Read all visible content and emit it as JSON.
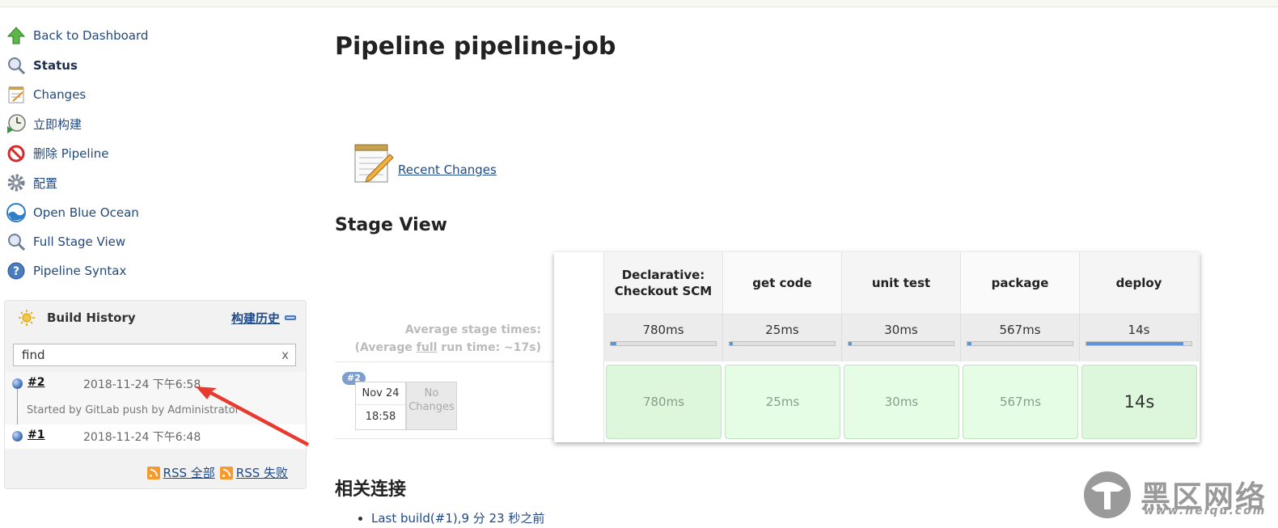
{
  "sidebar": {
    "tasks": [
      {
        "label": "Back to Dashboard",
        "icon": "up-arrow-icon"
      },
      {
        "label": "Status",
        "icon": "search-icon"
      },
      {
        "label": "Changes",
        "icon": "notepad-icon"
      },
      {
        "label": "立即构建",
        "icon": "clock-build-icon"
      },
      {
        "label": "删除 Pipeline",
        "icon": "no-entry-icon"
      },
      {
        "label": "配置",
        "icon": "gear-icon"
      },
      {
        "label": "Open Blue Ocean",
        "icon": "blue-ocean-icon"
      },
      {
        "label": "Full Stage View",
        "icon": "search-icon"
      },
      {
        "label": "Pipeline Syntax",
        "icon": "help-icon"
      }
    ]
  },
  "build_history": {
    "title": "Build History",
    "trend_label": "构建历史",
    "search": {
      "value": "find",
      "clear": "x"
    },
    "builds": [
      {
        "number": "#2",
        "date": "2018-11-24 下午6:58",
        "cause": "Started by GitLab push by Administrator"
      },
      {
        "number": "#1",
        "date": "2018-11-24 下午6:48"
      }
    ],
    "rss_all": "RSS 全部",
    "rss_failed": "RSS 失败"
  },
  "main": {
    "title": "Pipeline pipeline-job",
    "recent_changes": "Recent Changes",
    "stage_view_title": "Stage View",
    "related_title": "相关连接",
    "related_links": [
      "Last build(#1),9 分 23 秒之前"
    ]
  },
  "stage_view": {
    "avg_line1": "Average stage times:",
    "avg_line2_pre": "(Average ",
    "avg_line2_full": "full",
    "avg_line2_post": " run time: ~17s)",
    "run": {
      "badge": "#2",
      "date": "Nov 24",
      "time": "18:58",
      "no_changes": "No Changes"
    },
    "stages": [
      {
        "name": "Declarative: Checkout SCM",
        "avg": "780ms",
        "value": "780ms",
        "bar_fraction": 0.05
      },
      {
        "name": "get code",
        "avg": "25ms",
        "value": "25ms",
        "bar_fraction": 0.03
      },
      {
        "name": "unit test",
        "avg": "30ms",
        "value": "30ms",
        "bar_fraction": 0.03
      },
      {
        "name": "package",
        "avg": "567ms",
        "value": "567ms",
        "bar_fraction": 0.04
      },
      {
        "name": "deploy",
        "avg": "14s",
        "value": "14s",
        "bar_fraction": 0.92
      }
    ]
  },
  "watermark": {
    "text": "黑区网络",
    "url": "www.heiqu.com"
  },
  "colors": {
    "link": "#204a87",
    "stage_success": "#dcf7dc",
    "bar": "#5e93d4"
  }
}
